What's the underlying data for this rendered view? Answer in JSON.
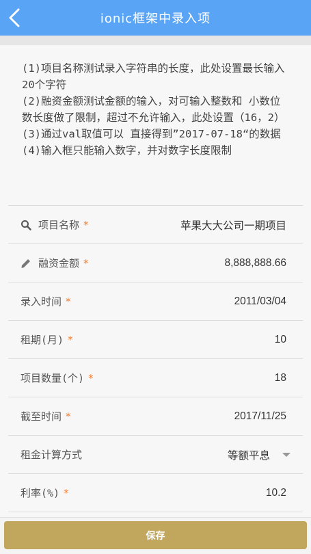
{
  "header": {
    "title": "ionic框架中录入项"
  },
  "notes": [
    "(1)项目名称测试录入字符串的长度，此处设置最长输入20个字符",
    "(2)融资金额测试金额的输入，对可输入整数和 小数位数长度做了限制，超过不允许输入，此处设置（16，2）",
    "(3)通过val取值可以 直接得到”2017-07-18“的数据",
    "(4)输入框只能输入数字，并对数字长度限制"
  ],
  "form": {
    "rows": [
      {
        "label": "项目名称",
        "required": "*",
        "value": "苹果大大公司一期项目",
        "icon": "search-icon"
      },
      {
        "label": "融资金额",
        "required": "*",
        "value": "8,888,888.66",
        "icon": "pencil-icon"
      },
      {
        "label": "录入时间",
        "required": "*",
        "value": "2011/03/04"
      },
      {
        "label": "租期(月)",
        "required": "*",
        "value": "10"
      },
      {
        "label": "项目数量(个)",
        "required": "*",
        "value": "18"
      },
      {
        "label": "截至时间",
        "required": "*",
        "value": "2017/11/25"
      },
      {
        "label": "租金计算方式",
        "required": "",
        "value": "等额平息",
        "icon": "chevron-down-icon"
      },
      {
        "label": "利率(%)",
        "required": "*",
        "value": "10.2"
      }
    ]
  },
  "footer": {
    "save_label": "保存"
  },
  "colors": {
    "header": "#5aa4f5",
    "required": "#f57c2a",
    "save_button": "#c1a65d"
  }
}
